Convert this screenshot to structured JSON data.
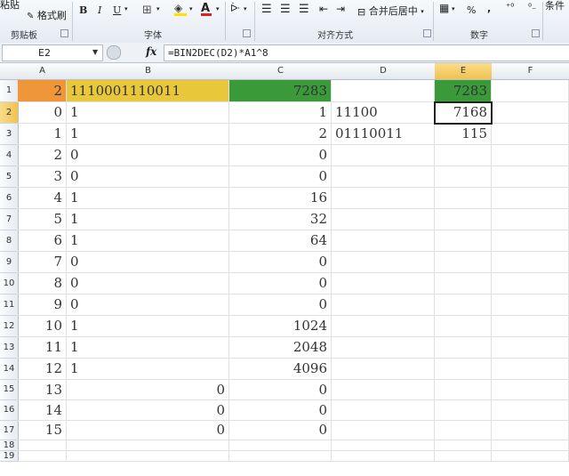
{
  "ribbon": {
    "paste_label": "粘贴",
    "format_painter_label": "格式刷",
    "bold": "B",
    "italic": "I",
    "underline": "U",
    "font_color_glyph": "A",
    "merge_center_label": "合并后居中",
    "percent": "%",
    "comma": ",",
    "conditional_label": "条件",
    "groups": {
      "clipboard": "剪贴板",
      "font": "字体",
      "alignment": "对齐方式",
      "number": "数字"
    },
    "colors": {
      "highlight": "#ffe000",
      "font_red": "#e02020"
    }
  },
  "formula_bar": {
    "name_box": "E2",
    "fx": "fx",
    "formula": "=BIN2DEC(D2)*A1^8"
  },
  "columns": [
    "A",
    "B",
    "C",
    "D",
    "E",
    "F"
  ],
  "rows": [
    "1",
    "2",
    "3",
    "4",
    "5",
    "6",
    "7",
    "8",
    "9",
    "10",
    "11",
    "12",
    "13",
    "14",
    "15",
    "16",
    "17",
    "18",
    "19"
  ],
  "cells": {
    "A": [
      "2",
      "0",
      "1",
      "2",
      "3",
      "4",
      "5",
      "6",
      "7",
      "8",
      "9",
      "10",
      "11",
      "12",
      "13",
      "14",
      "15",
      "",
      ""
    ],
    "B": [
      "1110001110011",
      "1",
      "1",
      "0",
      "0",
      "1",
      "1",
      "1",
      "0",
      "0",
      "0",
      "1",
      "1",
      "1",
      "0",
      "0",
      "0",
      "",
      ""
    ],
    "C": [
      "7283",
      "1",
      "2",
      "0",
      "0",
      "16",
      "32",
      "64",
      "0",
      "0",
      "0",
      "1024",
      "2048",
      "4096",
      "0",
      "0",
      "0",
      "",
      ""
    ],
    "D": [
      "",
      "11100",
      "01110011",
      "",
      "",
      "",
      "",
      "",
      "",
      "",
      "",
      "",
      "",
      "",
      "",
      "",
      "",
      "",
      ""
    ],
    "E": [
      "7283",
      "7168",
      "115",
      "",
      "",
      "",
      "",
      "",
      "",
      "",
      "",
      "",
      "",
      "",
      "",
      "",
      "",
      "",
      ""
    ]
  },
  "selected_cell": "E2",
  "fills": {
    "A1": "#f0963a",
    "B1": "#e8c83a",
    "C1": "#3a9a3a",
    "E1": "#3a9a3a"
  }
}
